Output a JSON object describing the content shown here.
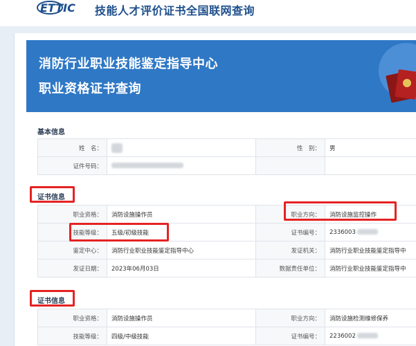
{
  "header": {
    "logo_text": "ETTIC",
    "site_title": "技能人才评价证书全国联网查询"
  },
  "banner": {
    "line1": "消防行业职业技能鉴定指导中心",
    "line2": "职业资格证书查询"
  },
  "basic_info": {
    "title": "基本信息",
    "name_label": "姓　名：",
    "gender_label": "性　别：",
    "gender_value": "男",
    "id_label": "证件号码："
  },
  "cert1": {
    "title": "证书信息",
    "qualification_label": "职业资格：",
    "qualification_value": "消防设施操作员",
    "direction_label": "职业方向：",
    "direction_value": "消防设施监控操作",
    "level_label": "技能等级：",
    "level_value": "五级/初级技能",
    "cert_no_label": "证书编号：",
    "cert_no_value": "2336003",
    "center_label": "鉴定中心：",
    "center_value": "消防行业职业技能鉴定指导中心",
    "issuer_label": "发证机关：",
    "issuer_value": "消防行业职业技能鉴定指导中",
    "date_label": "发证日期：",
    "date_value": "2023年06月03日",
    "unit_label": "数据责任单位：",
    "unit_value": "消防行业职业技能鉴定指导中"
  },
  "cert2": {
    "title": "证书信息",
    "qualification_label": "职业资格：",
    "qualification_value": "消防设施操作员",
    "direction_label": "职业方向：",
    "direction_value": "消防设施检测维修保养",
    "level_label": "技能等级：",
    "level_value": "四级/中级技能",
    "cert_no_label": "证书编号：",
    "cert_no_value": "2236002"
  },
  "colors": {
    "banner": "#2f78c5",
    "title_blue": "#1d4f8c",
    "highlight_red": "#e52222"
  }
}
